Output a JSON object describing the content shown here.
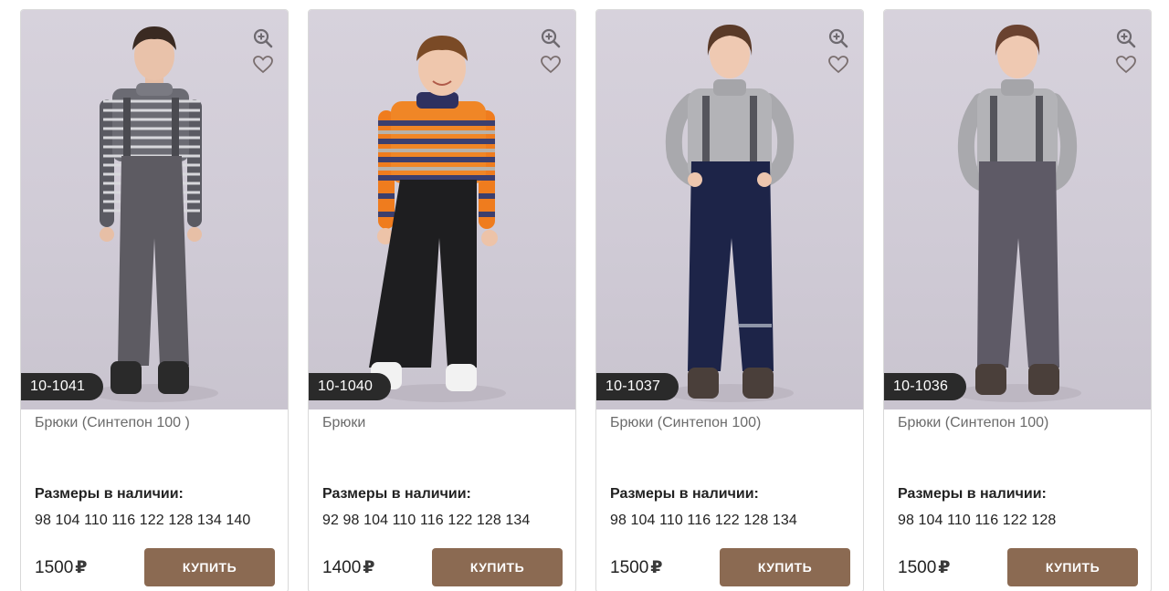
{
  "icons": {
    "zoom": "zoom-in-icon",
    "favorite": "heart-outline-icon"
  },
  "colors": {
    "button": "#8b6a52",
    "sku_badge": "#2a2a2a",
    "photo_bg": "#d3ced9"
  },
  "products": [
    {
      "sku": "10-1041",
      "name": "Брюки (Синтепон 100 )",
      "sizes_label": "Размеры в наличии:",
      "sizes": "98 104 110 116 122 128 134 140",
      "price": "1500",
      "currency": "₽",
      "buy_label": "КУПИТЬ"
    },
    {
      "sku": "10-1040",
      "name": "Брюки",
      "sizes_label": "Размеры в наличии:",
      "sizes": "92 98 104 110 116 122 128 134",
      "price": "1400",
      "currency": "₽",
      "buy_label": "КУПИТЬ"
    },
    {
      "sku": "10-1037",
      "name": "Брюки (Синтепон 100)",
      "sizes_label": "Размеры в наличии:",
      "sizes": "98 104 110 116 122 128 134",
      "price": "1500",
      "currency": "₽",
      "buy_label": "КУПИТЬ"
    },
    {
      "sku": "10-1036",
      "name": "Брюки (Синтепон 100)",
      "sizes_label": "Размеры в наличии:",
      "sizes": "98 104 110 116 122 128",
      "price": "1500",
      "currency": "₽",
      "buy_label": "КУПИТЬ"
    }
  ]
}
